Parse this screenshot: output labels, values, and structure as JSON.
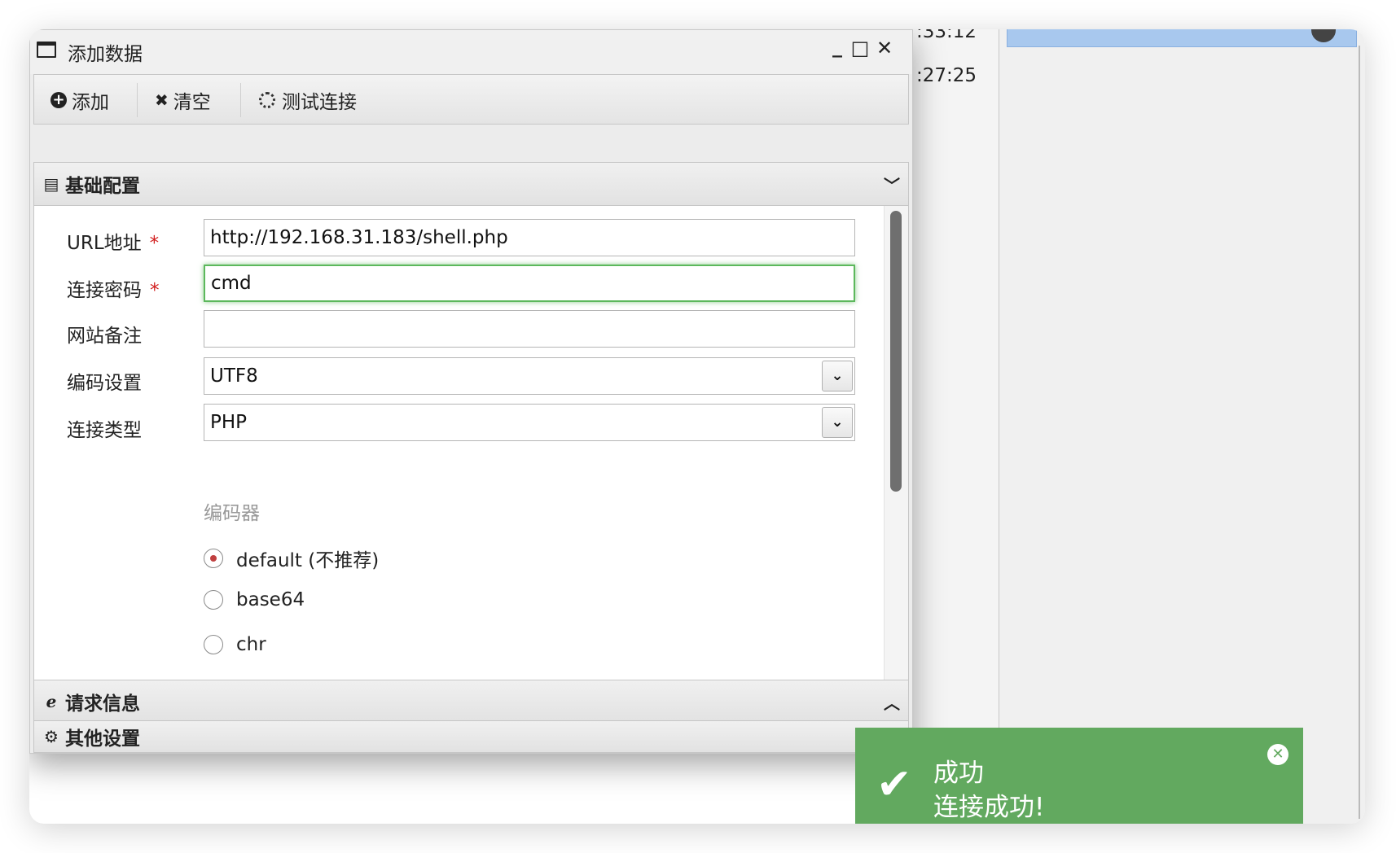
{
  "background": {
    "times": [
      ":33:12",
      ":27:25"
    ]
  },
  "dialog": {
    "title": "添加数据",
    "window_controls": {
      "minimize": "_",
      "maximize": "□",
      "close": "✕"
    },
    "toolbar": {
      "add_label": "添加",
      "clear_label": "清空",
      "test_label": "测试连接"
    },
    "sections": {
      "basic": "基础配置",
      "request": "请求信息",
      "other": "其他设置"
    },
    "form": {
      "url_label": "URL地址",
      "url_value": "http://192.168.31.183/shell.php",
      "password_label": "连接密码",
      "password_value": "cmd",
      "note_label": "网站备注",
      "note_value": "",
      "encoding_label": "编码设置",
      "encoding_value": "UTF8",
      "type_label": "连接类型",
      "type_value": "PHP",
      "required_mark": "*",
      "encoder_label": "编码器",
      "encoders": [
        "default (不推荐)",
        "base64",
        "chr"
      ],
      "encoder_selected": "default (不推荐)"
    }
  },
  "toast": {
    "title": "成功",
    "message": "连接成功!",
    "color": "#62a95f"
  }
}
